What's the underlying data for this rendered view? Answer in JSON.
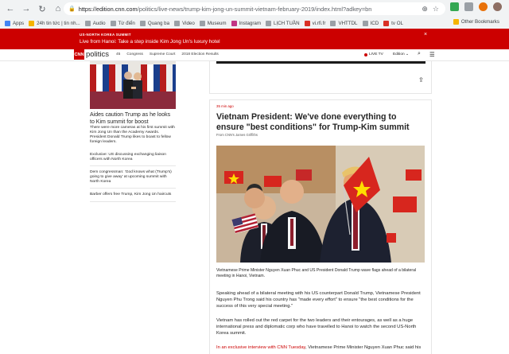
{
  "browser": {
    "url_host": "https://edition.cnn.com",
    "url_path": "/politics/live-news/trump-kim-jong-un-summit-vietnam-february-2019/index.html?adkey=bn",
    "bookmarks": [
      {
        "label": "Apps",
        "color": "#4285f4"
      },
      {
        "label": "24h tin tức | tin nh...",
        "color": "#f5b400"
      },
      {
        "label": "Audio",
        "color": "#9aa0a6"
      },
      {
        "label": "Từ điển",
        "color": "#9aa0a6"
      },
      {
        "label": "Quang ba",
        "color": "#9aa0a6"
      },
      {
        "label": "Video",
        "color": "#9aa0a6"
      },
      {
        "label": "Museum",
        "color": "#9aa0a6"
      },
      {
        "label": "Instagram",
        "color": "#c13584"
      },
      {
        "label": "LỊCH TUẦN",
        "color": "#9aa0a6"
      },
      {
        "label": "vi.rfi.fr",
        "color": "#d93025"
      },
      {
        "label": "VHTTDL",
        "color": "#9aa0a6"
      },
      {
        "label": "ICD",
        "color": "#9aa0a6"
      },
      {
        "label": "tv OL",
        "color": "#d93025"
      }
    ],
    "other_bookmarks": "Other Bookmarks"
  },
  "banner": {
    "label": "US-NORTH KOREA SUMMIT",
    "headline": "Live from Hanoi: Take a step inside Kim Jong Un's luxury hotel",
    "close": "×"
  },
  "nav": {
    "logo": "CNN",
    "section": "politics",
    "links": [
      "45",
      "Congress",
      "Supreme Court",
      "2018 Election Results"
    ],
    "live_tv": "LIVE TV",
    "edition": "Edition ⌄"
  },
  "left": {
    "title": "Aides caution Trump as he looks to Kim summit for boost",
    "description": "There were more cameras at his first summit with Kim Jong Un than the Academy Awards. President Donald Trump likes to boast to fellow foreign leaders.",
    "links": [
      "Exclusive: US discussing exchanging liaison officers with North Korea",
      "Dem congressman: 'God knows what (Trump's) going to give away' at upcoming summit with North Korea",
      "Barber offers free Trump, Kim Jong Un haircuts"
    ]
  },
  "article": {
    "time": "35 min ago",
    "title": "Vietnam President: We've done everything to ensure \"best conditions\" for Trump-Kim summit",
    "byline": "From CNN's James Griffiths",
    "caption": "Vietnamese Prime Minister Nguyen Xuan Phuc and US President Donald Trump wave flags ahead of a bilateral meeting in Hanoi, Vietnam.",
    "p1": "Speaking ahead of a bilateral meeting with his US counterpart Donald Trump, Vietnamese President Nguyen Phu Trong said his country has \"made every effort\" to ensure \"the best conditions for the success of this very special meeting.\"",
    "p2": "Vietnam has rolled out the red carpet for the two leaders and their entourages, as well as a huge international press and diplomatic corp who have travelled to Hanoi to watch the second US-North Korea summit.",
    "p3_link": "In an exclusive interview with CNN Tuesday",
    "p3_text": ", Vietnamese Prime Minister Nguyen Xuan Phuc said his"
  }
}
